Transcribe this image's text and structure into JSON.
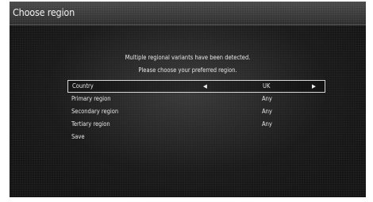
{
  "title": "Choose region",
  "message": {
    "line1": "Multiple regional variants have been detected.",
    "line2": "Please choose your preferred region."
  },
  "menu": {
    "country": {
      "label": "Country",
      "value": "UK",
      "left_icon": "triangle-left-icon",
      "right_icon": "triangle-right-icon",
      "left_glyph": "◀",
      "right_glyph": "▶"
    },
    "primary": {
      "label": "Primary region",
      "value": "Any"
    },
    "secondary": {
      "label": "Secondary region",
      "value": "Any"
    },
    "tertiary": {
      "label": "Tertiary region",
      "value": "Any"
    },
    "save": {
      "label": "Save"
    }
  },
  "colors": {
    "background": "#161616",
    "title_bar": "#3c3c3c",
    "text": "#e6e6e6",
    "selection_border": "#d8d8d8"
  }
}
